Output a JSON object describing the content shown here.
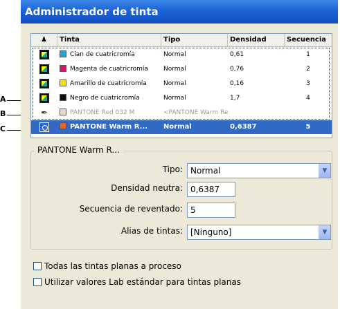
{
  "window": {
    "title": "Administrador de tinta"
  },
  "table": {
    "columns": [
      "Tinta",
      "Tipo",
      "Densidad",
      "Secuencia"
    ],
    "rows": [
      {
        "icon": "process-ink-icon",
        "swatch": "#2aa0d8",
        "name": "Cian de cuatricromía",
        "type": "Normal",
        "density": "0,61",
        "sequence": "1"
      },
      {
        "icon": "process-ink-icon",
        "swatch": "#d8156a",
        "name": "Magenta de cuatricromía",
        "type": "Normal",
        "density": "0,76",
        "sequence": "2"
      },
      {
        "icon": "process-ink-icon",
        "swatch": "#f2e21a",
        "name": "Amarillo de cuatricromía",
        "type": "Normal",
        "density": "0,16",
        "sequence": "3"
      },
      {
        "icon": "process-ink-icon",
        "swatch": "#111111",
        "name": "Negro de cuatricromía",
        "type": "Normal",
        "density": "1,7",
        "sequence": "4"
      },
      {
        "icon": "alias-ink-icon",
        "swatch": "#e8d8cc",
        "name": "PANTONE Red 032 M",
        "type": "<PANTONE Warm Red C>",
        "density": "",
        "sequence": ""
      },
      {
        "icon": "spot-ink-icon",
        "swatch": "#e8632a",
        "name": "PANTONE Warm R...",
        "type": "Normal",
        "density": "0,6387",
        "sequence": "5"
      }
    ]
  },
  "callouts": [
    "A",
    "B",
    "C"
  ],
  "details": {
    "group_title": "PANTONE Warm R...",
    "type_label": "Tipo:",
    "type_value": "Normal",
    "density_label": "Densidad neutra:",
    "density_value": "0,6387",
    "trap_label": "Secuencia de reventado:",
    "trap_value": "5",
    "alias_label": "Alias de tintas:",
    "alias_value": "[Ninguno]"
  },
  "options": {
    "all_to_process": "Todas las tintas planas a proceso",
    "use_lab": "Utilizar valores Lab estándar para tintas planas"
  }
}
